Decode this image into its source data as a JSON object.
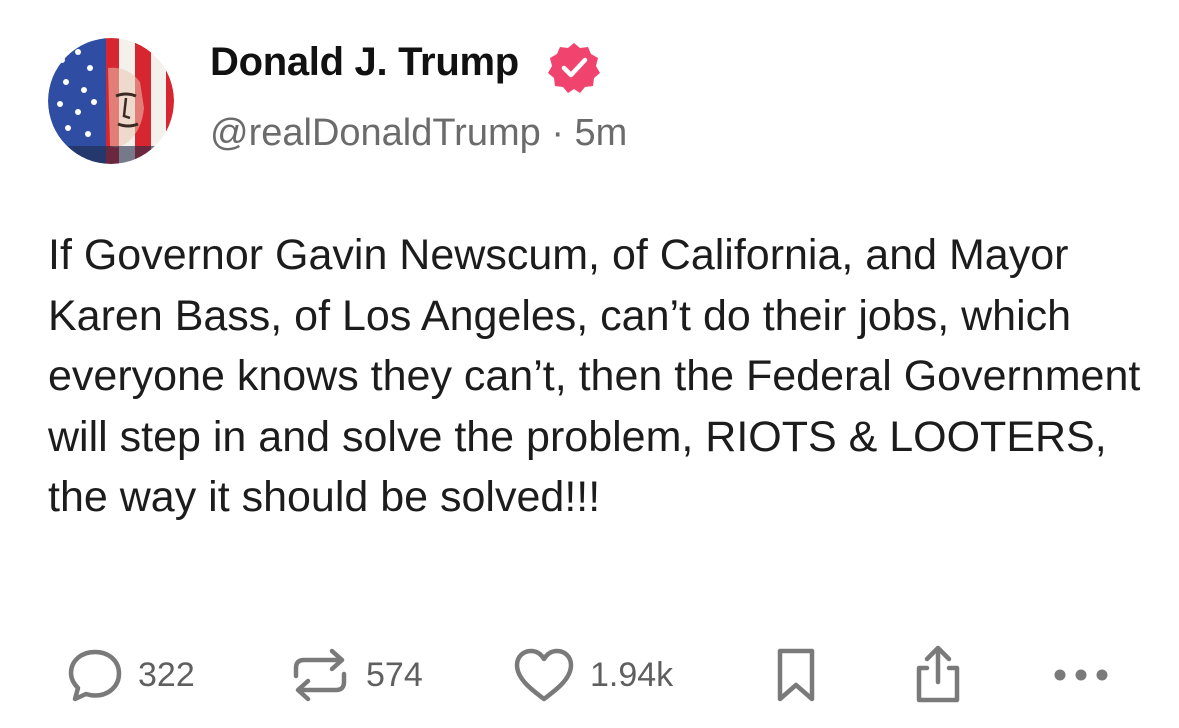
{
  "author": {
    "display_name": "Donald J. Trump",
    "handle": "@realDonaldTrump",
    "separator": "·",
    "time_ago": "5m",
    "verified": true,
    "verified_color": "#f0446e"
  },
  "post": {
    "text": "If Governor Gavin Newscum, of California, and Mayor Karen Bass, of Los Angeles, can’t do their jobs, which everyone knows they can’t, then the Federal Government will step in and solve the problem, RIOTS & LOOTERS, the way it should be solved!!!"
  },
  "actions": {
    "reply": {
      "icon": "reply-bubble-icon",
      "count": "322"
    },
    "repost": {
      "icon": "repost-icon",
      "count": "574"
    },
    "like": {
      "icon": "heart-icon",
      "count": "1.94k"
    },
    "bookmark": {
      "icon": "bookmark-icon"
    },
    "share": {
      "icon": "share-icon"
    },
    "more": {
      "icon": "more-dots-icon"
    }
  },
  "colors": {
    "text": "#1c1c1c",
    "muted": "#6b6b6b",
    "icon": "#7a7a7a",
    "background": "#ffffff"
  }
}
